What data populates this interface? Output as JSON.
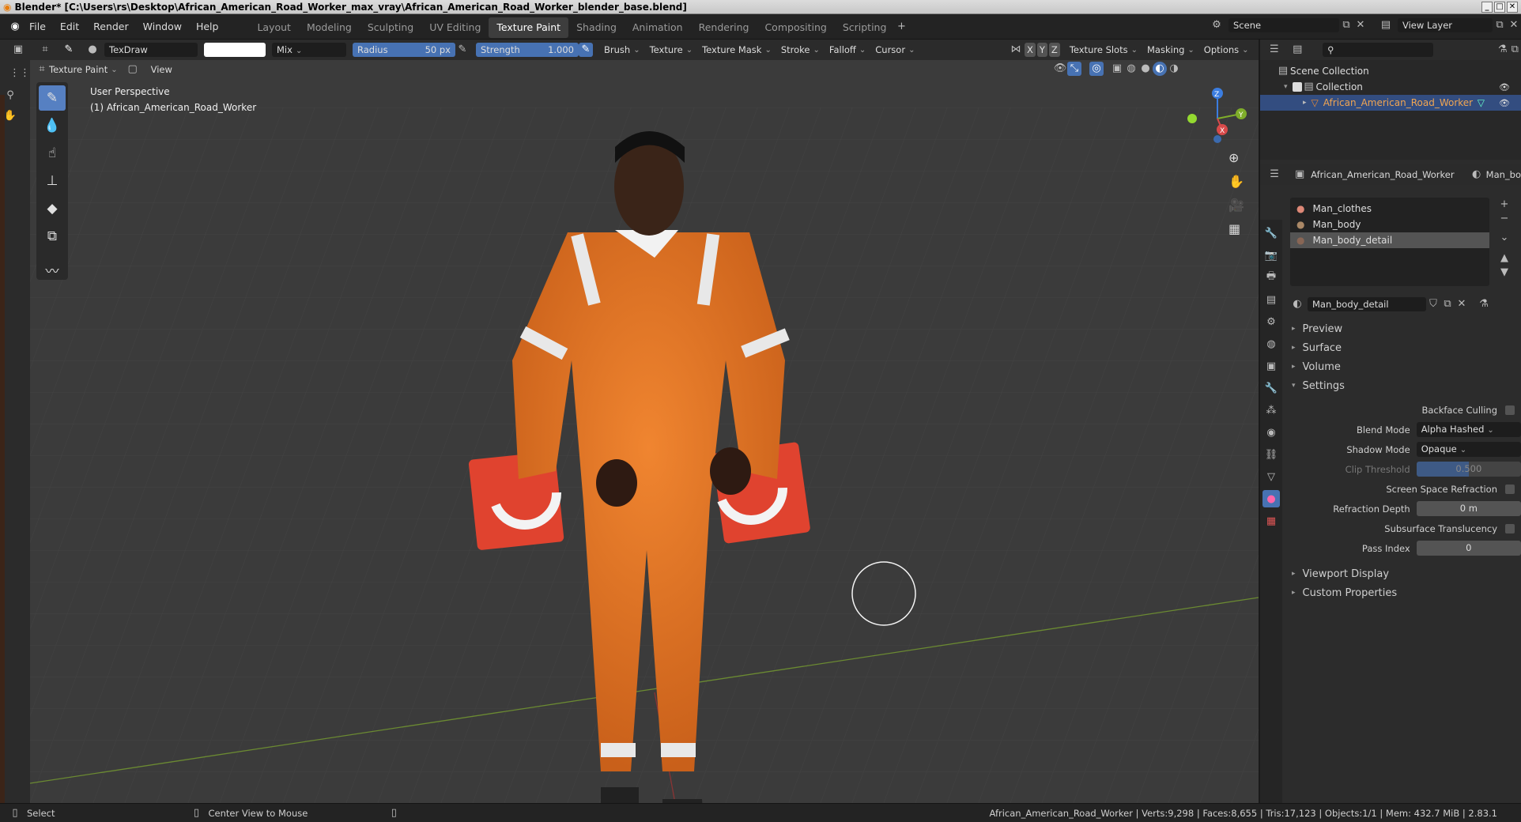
{
  "window": {
    "title": "Blender* [C:\\Users\\rs\\Desktop\\African_American_Road_Worker_max_vray\\African_American_Road_Worker_blender_base.blend]"
  },
  "menu": [
    "File",
    "Edit",
    "Render",
    "Window",
    "Help"
  ],
  "workspaces": [
    "Layout",
    "Modeling",
    "Sculpting",
    "UV Editing",
    "Texture Paint",
    "Shading",
    "Animation",
    "Rendering",
    "Compositing",
    "Scripting"
  ],
  "active_workspace": "Texture Paint",
  "scene": {
    "name": "Scene",
    "view_layer": "View Layer"
  },
  "tool_header": {
    "brush": "TexDraw",
    "blend": "Mix",
    "radius_label": "Radius",
    "radius_value": "50 px",
    "strength_label": "Strength",
    "strength_value": "1.000",
    "menus": [
      "Brush",
      "Texture",
      "Texture Mask",
      "Stroke",
      "Falloff",
      "Cursor"
    ],
    "right_menus": [
      "Texture Slots",
      "Masking",
      "Options"
    ],
    "axes": [
      "X",
      "Y",
      "Z"
    ]
  },
  "mode_header": {
    "mode": "Texture Paint",
    "view": "View"
  },
  "viewport": {
    "line1": "User Perspective",
    "line2": "(1) African_American_Road_Worker"
  },
  "gizmo": {
    "z": "Z",
    "y": "Y",
    "x": "X"
  },
  "outliner": {
    "root": "Scene Collection",
    "collection": "Collection",
    "object": "African_American_Road_Worker"
  },
  "properties": {
    "object": "African_American_Road_Worker",
    "mesh_tab": "Man_bo",
    "slots": [
      "Man_clothes",
      "Man_body",
      "Man_body_detail"
    ],
    "selected_slot": 2,
    "material": "Man_body_detail",
    "sections": [
      "Preview",
      "Surface",
      "Volume",
      "Settings"
    ],
    "settings": {
      "backface_culling": "Backface Culling",
      "blend_mode_label": "Blend Mode",
      "blend_mode": "Alpha Hashed",
      "shadow_mode_label": "Shadow Mode",
      "shadow_mode": "Opaque",
      "clip_label": "Clip Threshold",
      "clip": "0.500",
      "ssr": "Screen Space Refraction",
      "refr_label": "Refraction Depth",
      "refr": "0 m",
      "subsurface": "Subsurface Translucency",
      "pass_label": "Pass Index",
      "pass": "0"
    },
    "bottom_sections": [
      "Viewport Display",
      "Custom Properties"
    ]
  },
  "status": {
    "left1": "Select",
    "left2": "Center View to Mouse",
    "right": "African_American_Road_Worker | Verts:9,298 | Faces:8,655 | Tris:17,123 | Objects:1/1 | Mem: 432.7 MiB | 2.83.1"
  },
  "colors": {
    "accent": "#5680c2",
    "suit": "#e2711f",
    "cone": "#e8402f"
  }
}
